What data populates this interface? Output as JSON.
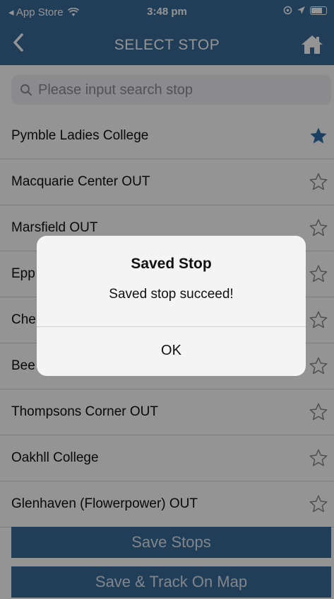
{
  "status_bar": {
    "back_app": "◂ App Store",
    "time": "3:48 pm"
  },
  "nav": {
    "back": "‹",
    "title": "SELECT STOP"
  },
  "search": {
    "placeholder": "Please input search stop",
    "value": ""
  },
  "stops": [
    {
      "name": "Pymble Ladies College",
      "saved": true
    },
    {
      "name": "Macquarie Center OUT",
      "saved": false
    },
    {
      "name": "Marsfield OUT",
      "saved": false
    },
    {
      "name": "Epp",
      "saved": false
    },
    {
      "name": "Che",
      "saved": false
    },
    {
      "name": "Bee",
      "saved": false
    },
    {
      "name": "Thompsons Corner OUT",
      "saved": false
    },
    {
      "name": "Oakhll College",
      "saved": false
    },
    {
      "name": "Glenhaven (Flowerpower) OUT",
      "saved": false
    }
  ],
  "buttons": {
    "save_stops": "Save Stops",
    "save_track": "Save & Track On Map"
  },
  "alert": {
    "title": "Saved Stop",
    "message": "Saved stop succeed!",
    "ok": "OK"
  },
  "colors": {
    "accent": "#3a6b9a",
    "star_filled": "#2f6ea8",
    "star_outline": "#8a8a8a"
  }
}
